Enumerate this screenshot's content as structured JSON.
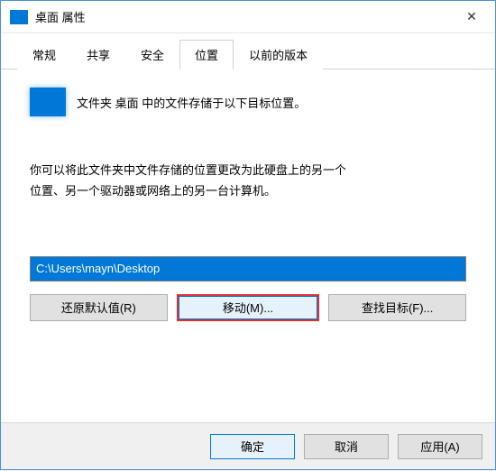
{
  "window": {
    "title": "桌面 属性"
  },
  "tabs": {
    "general": "常规",
    "sharing": "共享",
    "security": "安全",
    "location": "位置",
    "previous": "以前的版本"
  },
  "content": {
    "description": "文件夹 桌面 中的文件存储于以下目标位置。",
    "info_line1": "你可以将此文件夹中文件存储的位置更改为此硬盘上的另一个",
    "info_line2": "位置、另一个驱动器或网络上的另一台计算机。",
    "path_value": "C:\\Users\\mayn\\Desktop"
  },
  "buttons": {
    "restore_default": "还原默认值(R)",
    "move": "移动(M)...",
    "find_target": "查找目标(F)..."
  },
  "footer": {
    "ok": "确定",
    "cancel": "取消",
    "apply": "应用(A)"
  }
}
